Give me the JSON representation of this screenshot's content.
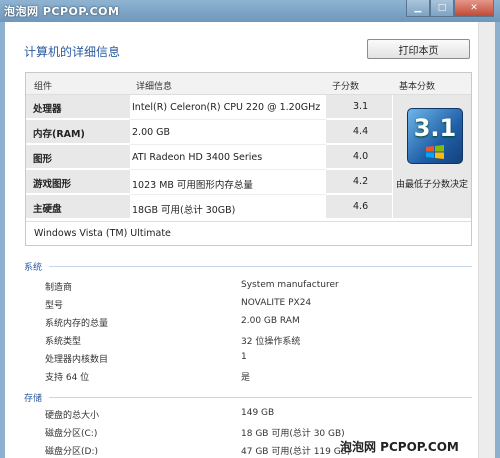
{
  "watermark": {
    "top": "泡泡网 PCPOP.COM",
    "bottom": "泡泡网 PCPOP.COM"
  },
  "page_title": "计算机的详细信息",
  "print_button": "打印本页",
  "score_table": {
    "headers": {
      "component": "组件",
      "details": "详细信息",
      "subscore": "子分数",
      "basescore": "基本分数"
    },
    "rows": [
      {
        "component": "处理器",
        "details": "Intel(R) Celeron(R) CPU 220 @ 1.20GHz",
        "score": "3.1"
      },
      {
        "component": "内存(RAM)",
        "details": "2.00 GB",
        "score": "4.4"
      },
      {
        "component": "图形",
        "details": "ATI Radeon HD 3400 Series",
        "score": "4.0"
      },
      {
        "component": "游戏图形",
        "details": "1023 MB 可用图形内存总量",
        "score": "4.2"
      },
      {
        "component": "主硬盘",
        "details": "18GB 可用(总计 30GB)",
        "score": "4.6"
      }
    ],
    "base_score": "3.1",
    "base_caption": "由最低子分数决定",
    "os": "Windows Vista (TM) Ultimate"
  },
  "system_section": {
    "title": "系统",
    "items": [
      {
        "label": "制造商",
        "value": "System manufacturer"
      },
      {
        "label": "型号",
        "value": "NOVALITE PX24"
      },
      {
        "label": "系统内存的总量",
        "value": "2.00 GB RAM"
      },
      {
        "label": "系统类型",
        "value": "32 位操作系统"
      },
      {
        "label": "处理器内核数目",
        "value": "1"
      },
      {
        "label": "支持 64 位",
        "value": "是"
      }
    ]
  },
  "storage_section": {
    "title": "存储",
    "items": [
      {
        "label": "硬盘的总大小",
        "value": "149 GB"
      },
      {
        "label": "磁盘分区(C:)",
        "value": "18 GB 可用(总计 30 GB)"
      },
      {
        "label": "磁盘分区(D:)",
        "value": "47 GB 可用(总计 119 GB)"
      }
    ]
  }
}
